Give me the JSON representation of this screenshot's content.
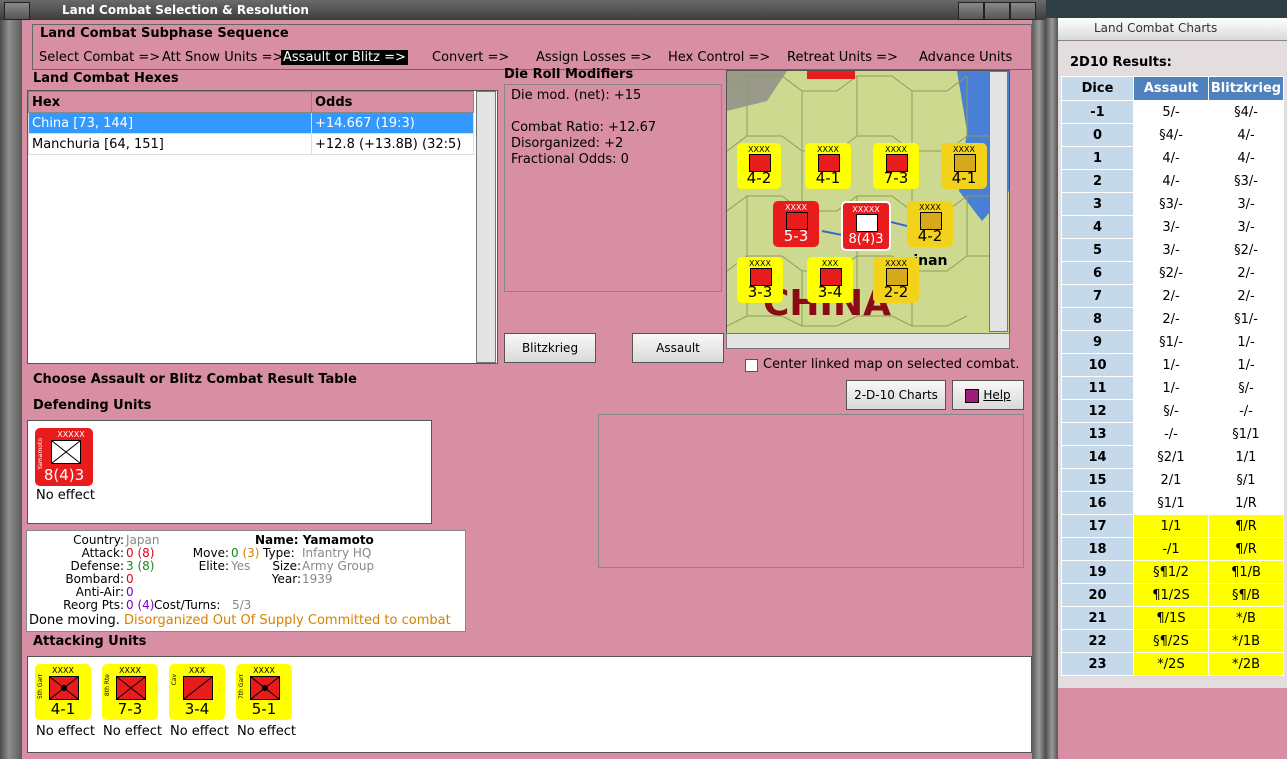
{
  "window": {
    "title": "Land Combat Selection & Resolution"
  },
  "sequence": {
    "title": "Land Combat Subphase Sequence",
    "steps": [
      "Select Combat =>",
      "Att Snow Units =>",
      "Assault or Blitz =>",
      "Convert =>",
      "Assign Losses =>",
      "Hex Control =>",
      "Retreat Units =>",
      "Advance Units"
    ]
  },
  "hexes": {
    "title": "Land Combat Hexes",
    "columns": [
      "Hex",
      "Odds"
    ],
    "rows": [
      {
        "hex": "China [73, 144]",
        "odds": "+14.667 (19:3)"
      },
      {
        "hex": "Manchuria [64, 151]",
        "odds": "+12.8 (+13.8B) (32:5)"
      }
    ]
  },
  "modifiers": {
    "title": "Die Roll Modifiers",
    "lines": [
      "Die mod. (net): +15",
      "",
      "Combat Ratio: +12.67",
      "Disorganized: +2",
      "Fractional Odds: 0"
    ]
  },
  "buttons": {
    "blitzkrieg": "Blitzkrieg",
    "assault": "Assault",
    "charts": "2-D-10 Charts",
    "help": "Help"
  },
  "map": {
    "center_label": "Center linked map on selected combat.",
    "place_china": "CHINA",
    "place_city": "sinan",
    "place_s": "S"
  },
  "instructions": "Choose Assault or Blitz Combat Result Table",
  "defending": {
    "title": "Defending Units",
    "units": [
      {
        "name": "Yamamoto",
        "size": "XXXXX",
        "value": "8(4)3",
        "effect": "No effect"
      }
    ]
  },
  "unit_info": {
    "country_label": "Country:",
    "country": "Japan",
    "attack_label": "Attack:",
    "attack": "0",
    "attack_p": "(8)",
    "defense_label": "Defense:",
    "defense": "3",
    "defense_p": "(8)",
    "bombard_label": "Bombard:",
    "bombard": "0",
    "antiair_label": "Anti-Air:",
    "antiair": "0",
    "reorg_label": "Reorg Pts:",
    "reorg": "0",
    "reorg_p": "(4)",
    "name_label": "Name:",
    "name": "Yamamoto",
    "move_label": "Move:",
    "move": "0",
    "move_p": "(3)",
    "elite_label": "Elite:",
    "elite": "Yes",
    "type_label": "Type:",
    "type": "Infantry HQ",
    "size_label": "Size:",
    "size": "Army Group",
    "year_label": "Year:",
    "year": "1939",
    "cost_label": "Cost/Turns:",
    "cost": "5/3",
    "status_done": "Done moving.",
    "status_dis": "Disorganized",
    "status_oos": "Out Of Supply",
    "status_com": "Committed to combat"
  },
  "attacking": {
    "title": "Attacking Units",
    "units": [
      {
        "name": "5th Garr",
        "size": "XXXX",
        "value": "4-1",
        "effect": "No effect"
      },
      {
        "name": "8th Rte",
        "size": "XXXX",
        "value": "7-3",
        "effect": "No effect"
      },
      {
        "name": "Cav",
        "size": "XXX",
        "value": "3-4",
        "effect": "No effect"
      },
      {
        "name": "7th Garr",
        "size": "XXXX",
        "value": "5-1",
        "effect": "No effect"
      }
    ]
  },
  "map_counters": [
    {
      "value": "4-2",
      "size": "XXXX"
    },
    {
      "value": "4-1",
      "size": "XXXX"
    },
    {
      "value": "7-3",
      "size": "XXXX"
    },
    {
      "value": "4-1",
      "size": "XXXX"
    },
    {
      "value": "5-3",
      "size": "XXXX"
    },
    {
      "value": "8(4)3",
      "size": "XXXXX"
    },
    {
      "value": "4-2",
      "size": "XXXX"
    },
    {
      "value": "3-3",
      "size": "XXXX"
    },
    {
      "value": "3-4",
      "size": "XXX"
    },
    {
      "value": "2-2",
      "size": "XXXX"
    }
  ],
  "charts_panel": {
    "title": "Land Combat Charts",
    "heading": "2D10 Results:",
    "columns": [
      "Dice",
      "Assault",
      "Blitzkrieg"
    ],
    "rows": [
      [
        "-1",
        "5/-",
        "§4/-"
      ],
      [
        "0",
        "§4/-",
        "4/-"
      ],
      [
        "1",
        "4/-",
        "4/-"
      ],
      [
        "2",
        "4/-",
        "§3/-"
      ],
      [
        "3",
        "§3/-",
        "3/-"
      ],
      [
        "4",
        "3/-",
        "3/-"
      ],
      [
        "5",
        "3/-",
        "§2/-"
      ],
      [
        "6",
        "§2/-",
        "2/-"
      ],
      [
        "7",
        "2/-",
        "2/-"
      ],
      [
        "8",
        "2/-",
        "§1/-"
      ],
      [
        "9",
        "§1/-",
        "1/-"
      ],
      [
        "10",
        "1/-",
        "1/-"
      ],
      [
        "11",
        "1/-",
        "§/-"
      ],
      [
        "12",
        "§/-",
        "-/-"
      ],
      [
        "13",
        "-/-",
        "§1/1"
      ],
      [
        "14",
        "§2/1",
        "1/1"
      ],
      [
        "15",
        "2/1",
        "§/1"
      ],
      [
        "16",
        "§1/1",
        "1/R"
      ],
      [
        "17",
        "1/1",
        "¶/R"
      ],
      [
        "18",
        "-/1",
        "¶/R"
      ],
      [
        "19",
        "§¶1/2",
        "¶1/B"
      ],
      [
        "20",
        "¶1/2S",
        "§¶/B"
      ],
      [
        "21",
        "¶/1S",
        "*/B"
      ],
      [
        "22",
        "§¶/2S",
        "*/1B"
      ],
      [
        "23",
        "*/2S",
        "*/2B"
      ]
    ],
    "highlight_from": 17
  }
}
